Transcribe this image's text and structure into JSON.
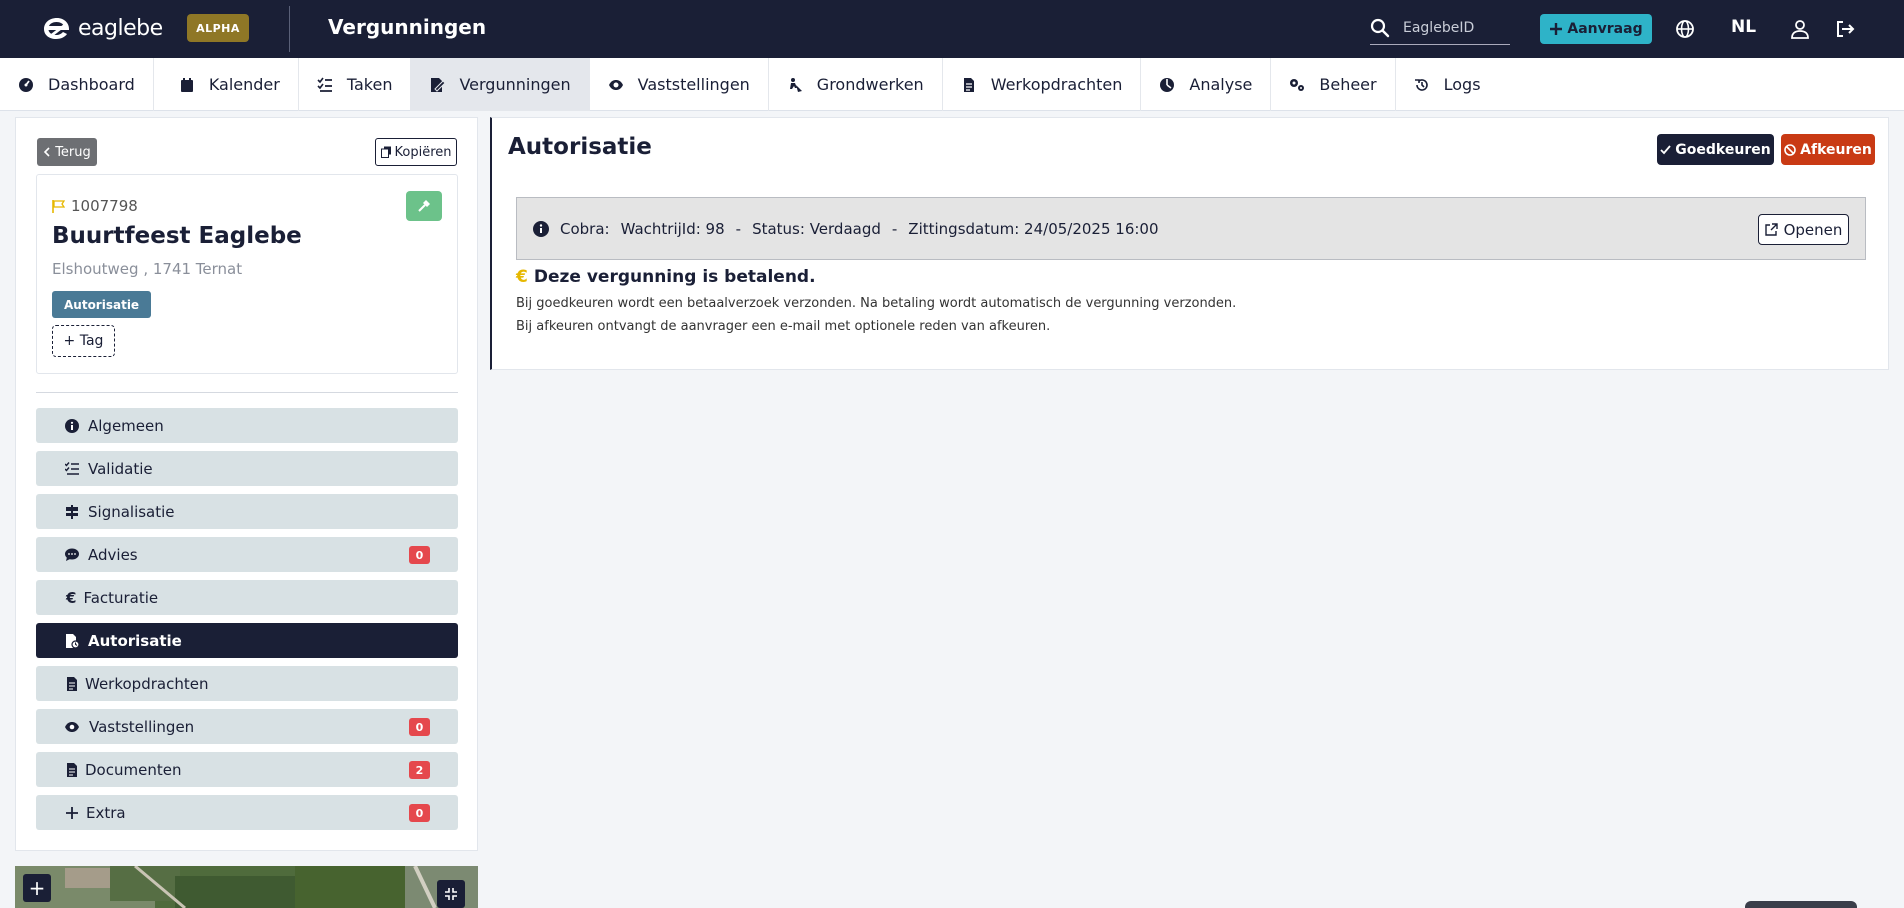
{
  "header": {
    "logo_text": "eaglebe",
    "badge": "ALPHA",
    "title": "Vergunningen",
    "search_placeholder": "EaglebeID",
    "new_request_label": "Aanvraag",
    "language": "NL"
  },
  "nav": {
    "items": [
      {
        "label": "Dashboard",
        "icon": "gauge-icon"
      },
      {
        "label": "Kalender",
        "icon": "calendar-icon"
      },
      {
        "label": "Taken",
        "icon": "tasks-icon"
      },
      {
        "label": "Vergunningen",
        "icon": "permit-icon",
        "active": true
      },
      {
        "label": "Vaststellingen",
        "icon": "eye-icon"
      },
      {
        "label": "Grondwerken",
        "icon": "digging-icon"
      },
      {
        "label": "Werkopdrachten",
        "icon": "file-icon"
      },
      {
        "label": "Analyse",
        "icon": "chart-icon"
      },
      {
        "label": "Beheer",
        "icon": "gears-icon"
      },
      {
        "label": "Logs",
        "icon": "history-icon"
      }
    ]
  },
  "left": {
    "back_label": "Terug",
    "copy_label": "Kopiëren",
    "card": {
      "id": "1007798",
      "title": "Buurtfeest Eaglebe",
      "address": "Elshoutweg , 1741 Ternat",
      "status": "Autorisatie",
      "add_tag_label": "+ Tag"
    },
    "menu": [
      {
        "label": "Algemeen",
        "icon": "info-icon"
      },
      {
        "label": "Validatie",
        "icon": "list-check-icon"
      },
      {
        "label": "Signalisatie",
        "icon": "signs-icon"
      },
      {
        "label": "Advies",
        "icon": "comment-icon",
        "count": "0"
      },
      {
        "label": "Facturatie",
        "icon": "euro-icon"
      },
      {
        "label": "Autorisatie",
        "icon": "file-lock-icon",
        "active": true
      },
      {
        "label": "Werkopdrachten",
        "icon": "file-icon"
      },
      {
        "label": "Vaststellingen",
        "icon": "eye-icon",
        "count": "0"
      },
      {
        "label": "Documenten",
        "icon": "file-icon",
        "count": "2"
      },
      {
        "label": "Extra",
        "icon": "plus-icon",
        "count": "0"
      }
    ],
    "map_zoom_label": "+"
  },
  "main": {
    "title": "Autorisatie",
    "approve_label": "Goedkeuren",
    "reject_label": "Afkeuren",
    "cobra": {
      "label": "Cobra:",
      "wait": "WachtrijId: 98",
      "sep": "-",
      "status": "Status: Verdaagd",
      "date": "Zittingsdatum: 24/05/2025 16:00",
      "open_label": "Openen"
    },
    "payment": {
      "symbol": "€",
      "title": "Deze vergunning is betalend.",
      "line1": "Bij goedkeuren wordt een betaalverzoek verzonden. Na betaling wordt automatisch de vergunning verzonden.",
      "line2": "Bij afkeuren ontvangt de aanvrager een e-mail met optionele reden van afkeuren."
    }
  },
  "colors": {
    "header_bg": "#1a1f36",
    "accent": "#2eb3c8",
    "alpha_badge": "#8f7726",
    "danger": "#c93a14",
    "status_badge": "#4a7a96",
    "success": "#6cc28a"
  }
}
